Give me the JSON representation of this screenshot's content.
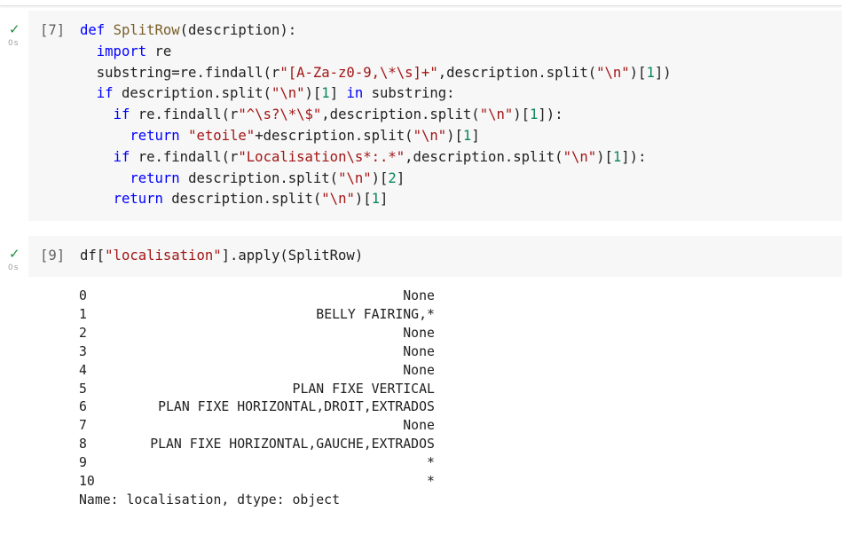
{
  "cells": [
    {
      "exec_count": "[7]",
      "exec_time": "0s",
      "status": "success",
      "code": {
        "def": "def",
        "fn_name": "SplitRow",
        "params": "(description):",
        "import_kw": "import",
        "import_mod": "re",
        "l3_a": "substring=re.findall(r",
        "l3_str": "\"[A-Za-z0-9,\\*\\s]+\"",
        "l3_b": ",description.split(",
        "l3_str2": "\"\\n\"",
        "l3_c": ")[",
        "l3_num": "1",
        "l3_d": "])",
        "l4_if": "if",
        "l4_a": " description.split(",
        "l4_str": "\"\\n\"",
        "l4_b": ")[",
        "l4_num": "1",
        "l4_c": "] ",
        "l4_in": "in",
        "l4_d": " substring:",
        "l5_if": "if",
        "l5_a": " re.findall(r",
        "l5_str": "\"^\\s?\\*\\$\"",
        "l5_b": ",description.split(",
        "l5_str2": "\"\\n\"",
        "l5_c": ")[",
        "l5_num": "1",
        "l5_d": "]):",
        "l6_ret": "return",
        "l6_str": " \"etoile\"",
        "l6_a": "+description.split(",
        "l6_str2": "\"\\n\"",
        "l6_b": ")[",
        "l6_num": "1",
        "l6_c": "]",
        "l7_if": "if",
        "l7_a": " re.findall(r",
        "l7_str": "\"Localisation\\s*:.*\"",
        "l7_b": ",description.split(",
        "l7_str2": "\"\\n\"",
        "l7_c": ")[",
        "l7_num": "1",
        "l7_d": "]):",
        "l8_ret": "return",
        "l8_a": " description.split(",
        "l8_str": "\"\\n\"",
        "l8_b": ")[",
        "l8_num": "2",
        "l8_c": "]",
        "l9_ret": "return",
        "l9_a": " description.split(",
        "l9_str": "\"\\n\"",
        "l9_b": ")[",
        "l9_num": "1",
        "l9_c": "]"
      }
    },
    {
      "exec_count": "[9]",
      "exec_time": "0s",
      "status": "success",
      "code": {
        "a": "df[",
        "str": "\"localisation\"",
        "b": "].apply(SplitRow)"
      }
    }
  ],
  "output": {
    "rows": [
      {
        "index": "0",
        "value": "None"
      },
      {
        "index": "1",
        "value": "BELLY FAIRING,*"
      },
      {
        "index": "2",
        "value": "None"
      },
      {
        "index": "3",
        "value": "None"
      },
      {
        "index": "4",
        "value": "None"
      },
      {
        "index": "5",
        "value": "PLAN FIXE VERTICAL"
      },
      {
        "index": "6",
        "value": "PLAN FIXE HORIZONTAL,DROIT,EXTRADOS"
      },
      {
        "index": "7",
        "value": "None"
      },
      {
        "index": "8",
        "value": "PLAN FIXE HORIZONTAL,GAUCHE,EXTRADOS"
      },
      {
        "index": "9",
        "value": "*"
      },
      {
        "index": "10",
        "value": "*"
      }
    ],
    "footer": "Name: localisation, dtype: object"
  },
  "colors": {
    "keyword": "#0000ff",
    "function": "#795e26",
    "string": "#a31515",
    "number": "#098658",
    "success_check": "#1e8e3e",
    "cell_background": "#f7f7f7"
  }
}
